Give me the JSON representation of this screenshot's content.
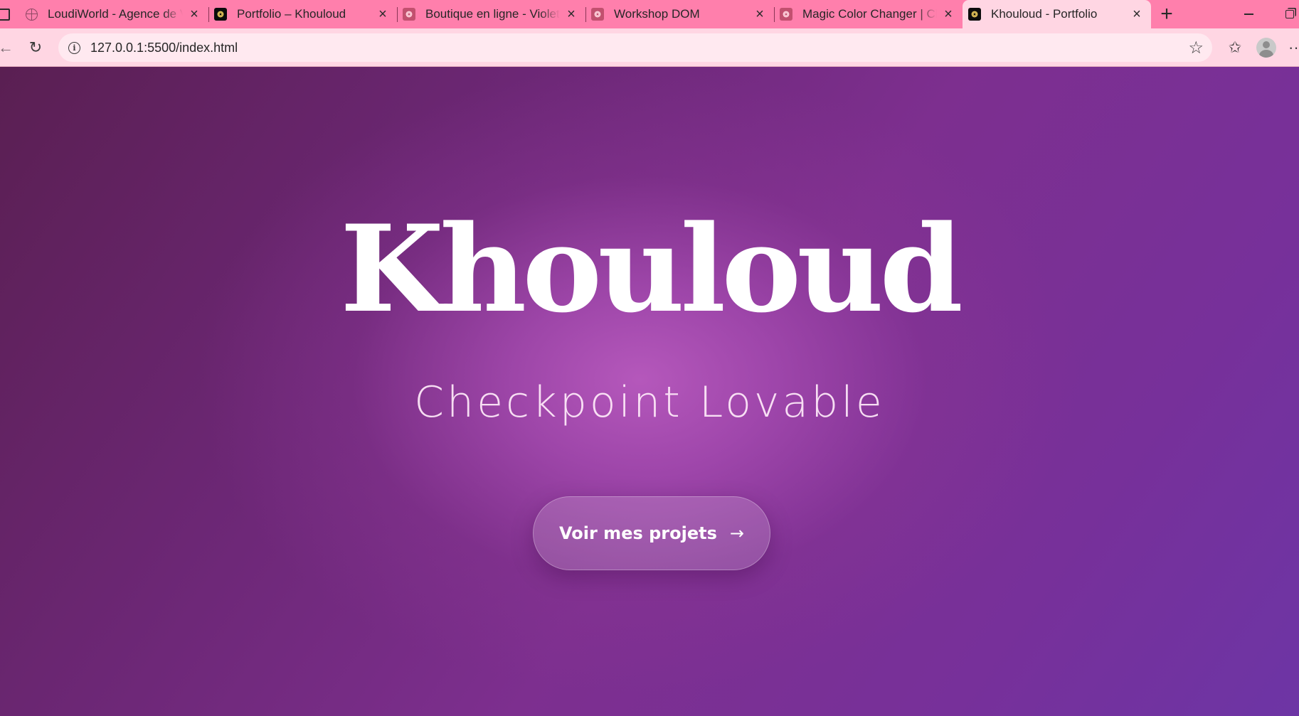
{
  "browser": {
    "tabs": [
      {
        "title": "LoudiWorld - Agence de Voy",
        "favicon": "globe-icon",
        "active": false
      },
      {
        "title": "Portfolio – Khouloud",
        "favicon": "dark-logo-icon",
        "active": false
      },
      {
        "title": "Boutique en ligne - Violet/Li",
        "favicon": "pink-logo-icon",
        "active": false
      },
      {
        "title": "Workshop DOM",
        "favicon": "pink-logo-icon",
        "active": false
      },
      {
        "title": "Magic Color Changer | Chang",
        "favicon": "pink-logo-icon",
        "active": false
      },
      {
        "title": "Khouloud - Portfolio",
        "favicon": "dark-logo-icon",
        "active": true
      }
    ],
    "close_glyph": "×",
    "new_tab_glyph": "+",
    "address": {
      "url": "127.0.0.1:5500/index.html"
    },
    "colors": {
      "tabstrip": "#ff7fac",
      "toolbar": "#ffd6e3",
      "omnibox": "#ffe9f0"
    }
  },
  "page": {
    "title": "Khouloud",
    "subtitle": "Checkpoint Lovable",
    "cta_label": "Voir mes projets",
    "cta_icon": "arrow-right-icon",
    "colors": {
      "background_dark": "#5a1f52",
      "background_glow": "#b85abe",
      "text": "#ffffff"
    }
  }
}
